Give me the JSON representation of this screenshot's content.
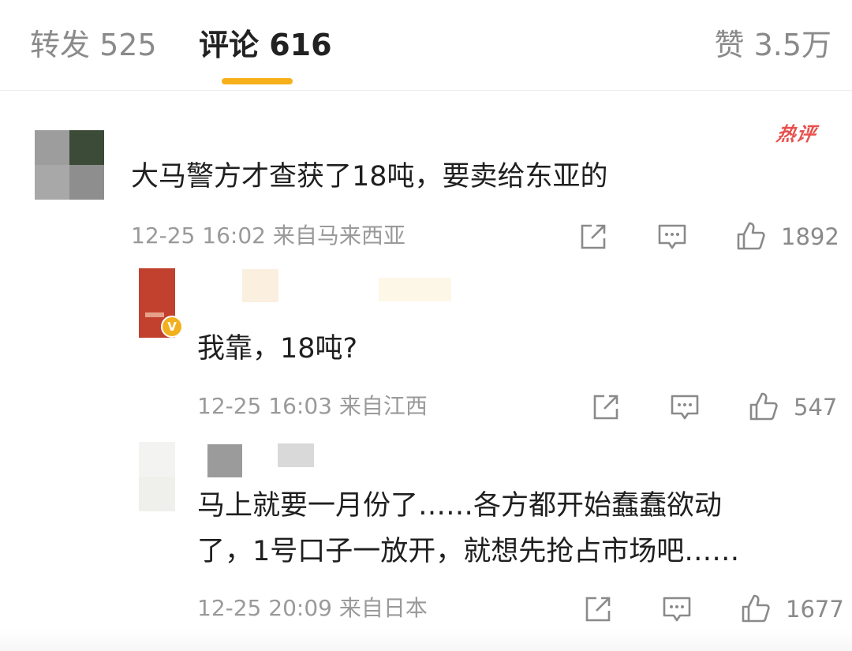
{
  "tabs": {
    "forward": "转发 525",
    "comments": "评论 616",
    "likes": "赞 3.5万"
  },
  "comments": [
    {
      "hot_badge": "热评",
      "content": "大马警方才查获了18吨，要卖给东亚的",
      "meta": "12-25 16:02 来自马来西亚",
      "like_count": "1892"
    },
    {
      "content": "我靠，18吨?",
      "meta": "12-25 16:03 来自江西",
      "like_count": "547"
    },
    {
      "content_line1": "马上就要一月份了……各方都开始蠢蠢欲动",
      "content_line2": "了，1号口子一放开，就想先抢占市场吧……",
      "meta": "12-25 20:09 来自日本",
      "like_count": "1677"
    }
  ],
  "icons": {
    "share": "share-icon",
    "comment": "comment-icon",
    "like": "thumbs-up-icon",
    "verified": "verified-badge-icon"
  },
  "colors": {
    "accent_underline": "#f6b01b",
    "hot_badge": "#e8504c",
    "meta_text": "#9a9a9a"
  }
}
